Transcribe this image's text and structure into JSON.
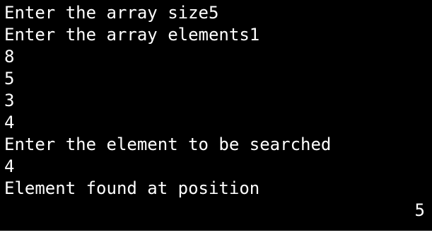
{
  "terminal": {
    "background": "#000000",
    "foreground": "#ffffff",
    "lines": [
      "Enter the array size5",
      "Enter the array elements1",
      "8",
      "5",
      "3",
      "4",
      "Enter the element to be searched",
      "4",
      "Element found at position"
    ],
    "result_value": "5"
  }
}
